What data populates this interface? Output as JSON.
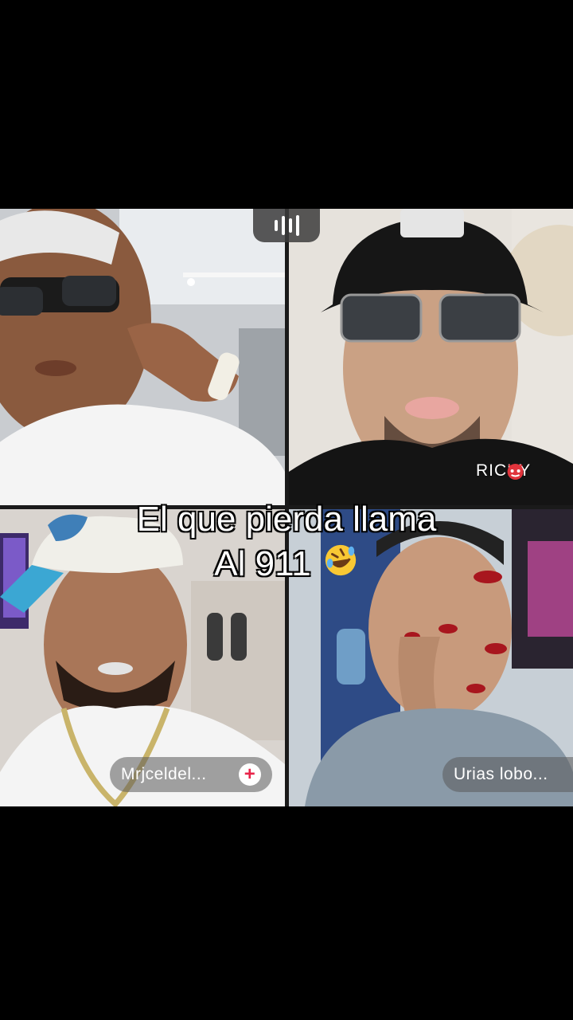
{
  "call": {
    "participants": [
      {
        "position": "top-left",
        "name": ""
      },
      {
        "position": "top-right",
        "name": "RICKY"
      },
      {
        "position": "bottom-left",
        "name": "Mrjceldel..."
      },
      {
        "position": "bottom-right",
        "name": "Urias lobo..."
      }
    ],
    "ricky_label": "RICKY",
    "chip_bottom_left": "Mrjceldel...",
    "chip_bottom_right": "Urias lobo...",
    "plus_symbol": "+",
    "audio_icon": "audio-level-icon",
    "devil_icon": "devil-face-icon",
    "laugh_icon": "rolling-laughing-emoji",
    "accent_plus": "#e8254a"
  },
  "caption": {
    "line1": "El que pierda llama",
    "line2": "Al 911"
  }
}
